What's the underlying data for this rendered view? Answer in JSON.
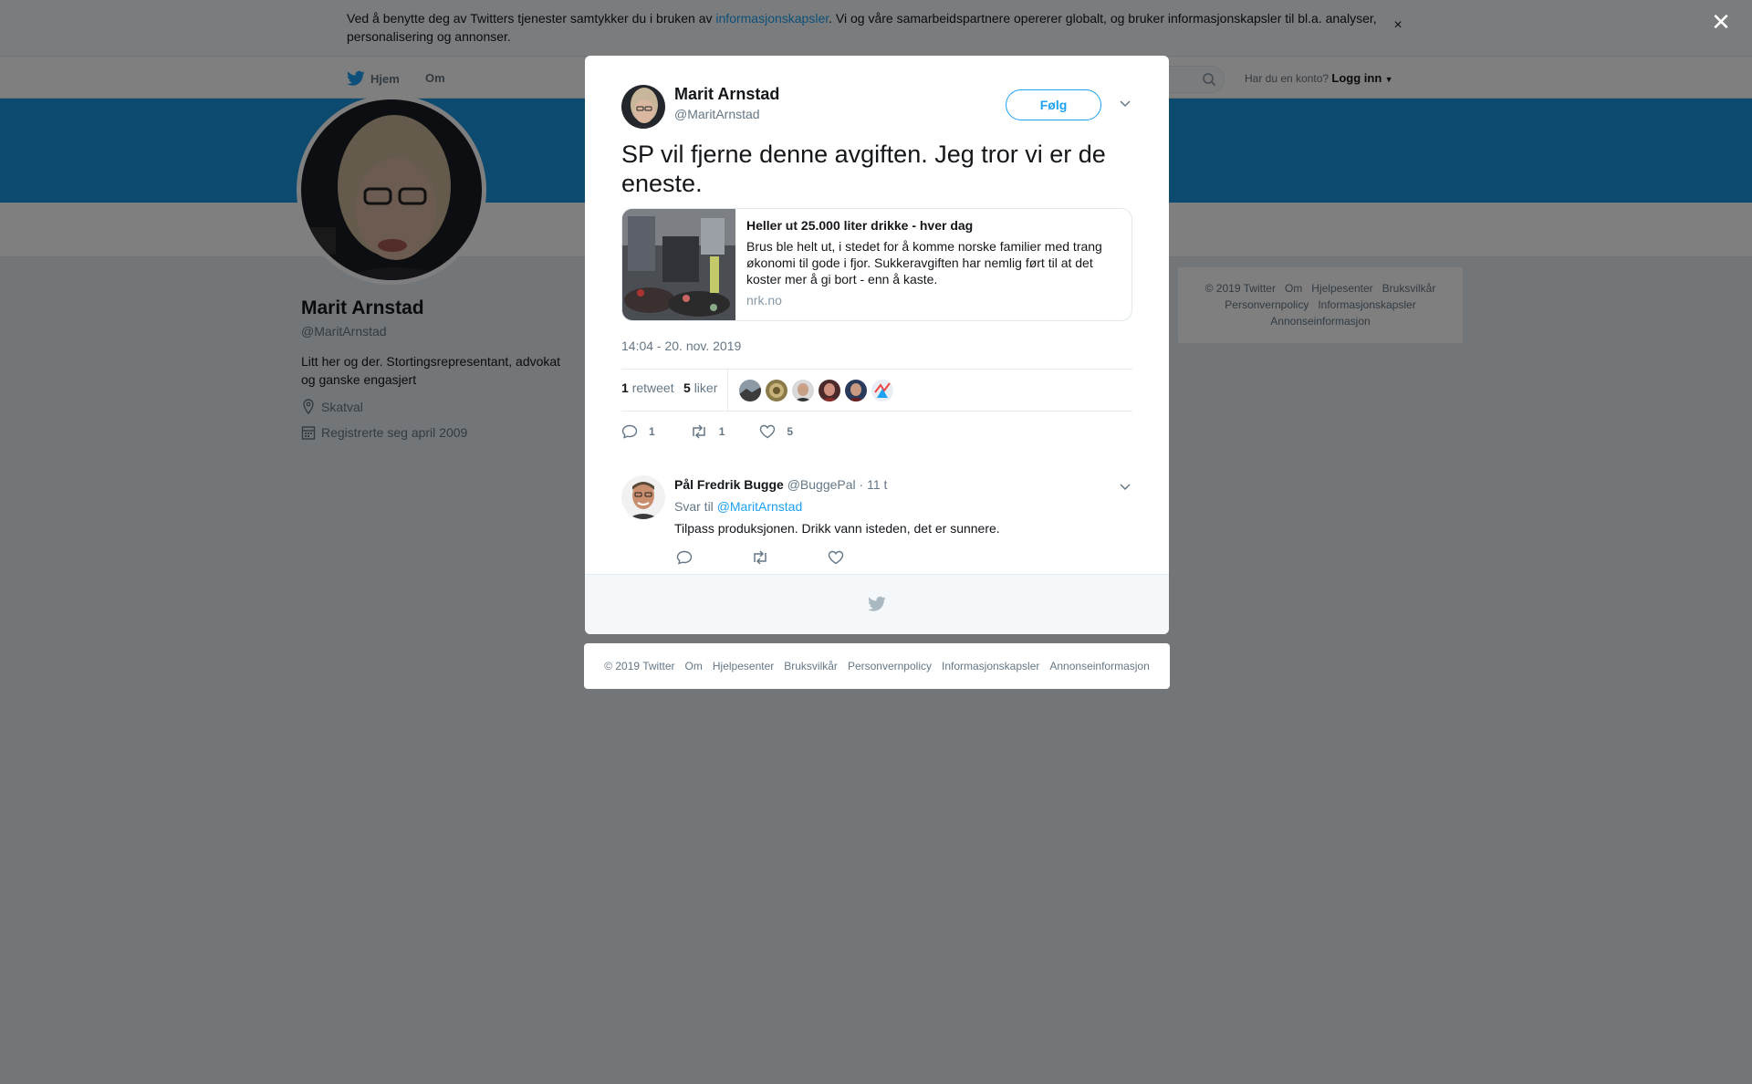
{
  "cookie_banner": {
    "text_before": "Ved å benytte deg av Twitters tjenester samtykker du i bruken av ",
    "link": "informasjonskapsler",
    "text_after": ". Vi og våre samarbeidspartnere opererer globalt, og bruker informasjonskapsler til bl.a. analyser, personalisering og annonser.",
    "close": "×"
  },
  "nav": {
    "home": "Hjem",
    "about": "Om",
    "account_prompt": "Har du en konto?",
    "login": "Logg inn"
  },
  "profile": {
    "name": "Marit Arnstad",
    "handle": "@MaritArnstad",
    "bio": "Litt her og der. Stortingsrepresentant, advokat og ganske engasjert",
    "location": "Skatval",
    "joined": "Registrerte seg april 2009"
  },
  "side_footer": {
    "links": [
      "© 2019 Twitter",
      "Om",
      "Hjelpesenter",
      "Bruksvilkår",
      "Personvernpolicy",
      "Informasjonskapsler",
      "Annonseinformasjon"
    ]
  },
  "overlay_close": "✕",
  "tweet": {
    "author_name": "Marit Arnstad",
    "author_handle": "@MaritArnstad",
    "follow": "Følg",
    "text": "SP vil fjerne denne avgiften. Jeg tror vi er de eneste.",
    "card": {
      "title": "Heller ut 25.000 liter drikke - hver dag",
      "description": "Brus ble helt ut, i stedet for å komme norske familier med trang økonomi til gode i fjor. Sukkeravgiften har nemlig ført til at det koster mer å gi bort - enn å kaste.",
      "domain": "nrk.no"
    },
    "timestamp": "14:04 - 20. nov. 2019",
    "retweets_count": "1",
    "retweets_label": "retweet",
    "likes_count": "5",
    "likes_label": "liker",
    "action_reply_count": "1",
    "action_retweet_count": "1",
    "action_like_count": "5"
  },
  "reply": {
    "name": "Pål Fredrik Bugge",
    "handle": "@BuggePal",
    "time": "· 11 t",
    "reply_to_label": "Svar til",
    "reply_to_mention": "@MaritArnstad",
    "text": "Tilpass produksjonen. Drikk vann isteden, det er sunnere."
  },
  "modal_footer": {
    "links": [
      "© 2019 Twitter",
      "Om",
      "Hjelpesenter",
      "Bruksvilkår",
      "Personvernpolicy",
      "Informasjonskapsler",
      "Annonseinformasjon"
    ]
  },
  "colors": {
    "accent": "#1da1f2",
    "banner": "#1b95e0",
    "secondary_text": "#657786"
  }
}
